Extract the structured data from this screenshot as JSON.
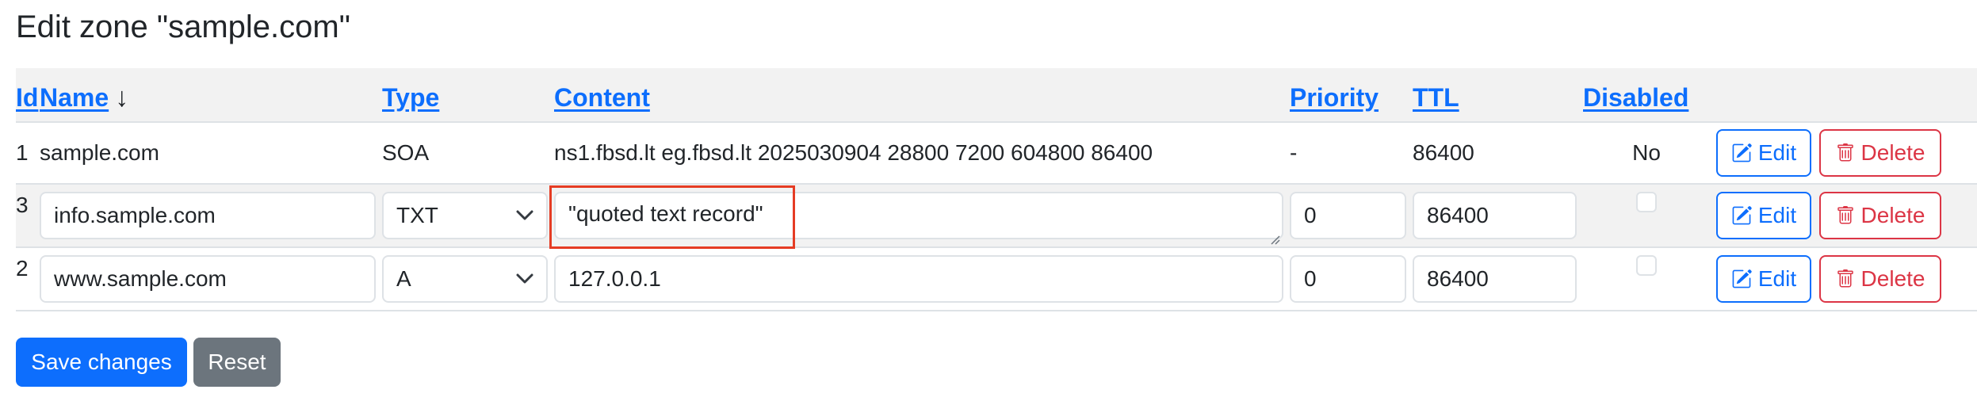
{
  "page": {
    "title": "Edit zone \"sample.com\""
  },
  "table": {
    "columns": {
      "id": "Id",
      "name": "Name",
      "name_sort": "↓",
      "type": "Type",
      "content": "Content",
      "priority": "Priority",
      "ttl": "TTL",
      "disabled": "Disabled"
    },
    "rows": [
      {
        "id": "1",
        "name": "sample.com",
        "type": "SOA",
        "content": "ns1.fbsd.lt eg.fbsd.lt 2025030904 28800 7200 604800 86400",
        "priority": "-",
        "ttl": "86400",
        "disabled": "No",
        "editable": false
      },
      {
        "id": "3",
        "name": "info.sample.com",
        "type": "TXT",
        "content": "\"quoted text record\"",
        "priority": "0",
        "ttl": "86400",
        "disabled": false,
        "editable": true
      },
      {
        "id": "2",
        "name": "www.sample.com",
        "type": "A",
        "content": "127.0.0.1",
        "priority": "0",
        "ttl": "86400",
        "disabled": false,
        "editable": true
      }
    ]
  },
  "actions": {
    "edit": "Edit",
    "delete": "Delete"
  },
  "footer": {
    "save": "Save changes",
    "reset": "Reset"
  },
  "colors": {
    "primary": "#0d6efd",
    "danger": "#dc3545",
    "secondary": "#6c757d",
    "highlight": "#e53c24",
    "stripe": "#f2f2f2"
  },
  "icons": {
    "edit": "pencil-square-icon",
    "delete": "trash-icon",
    "select": "chevron-down-icon",
    "resize": "resize-grip-icon"
  }
}
